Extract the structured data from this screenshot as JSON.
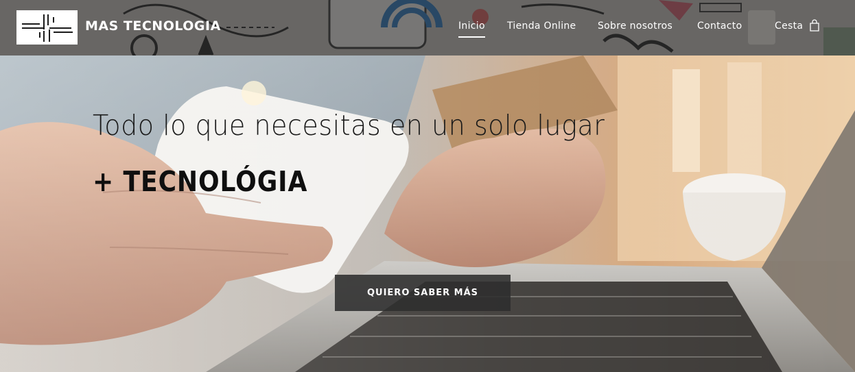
{
  "brand": {
    "name": "MAS TECNOLOGIA"
  },
  "nav": {
    "items": [
      {
        "label": "Inicio",
        "active": true
      },
      {
        "label": "Tienda Online",
        "active": false
      },
      {
        "label": "Sobre nosotros",
        "active": false
      },
      {
        "label": "Contacto",
        "active": false
      }
    ],
    "cart_label": "Cesta",
    "cart_icon": "shopping-bag-icon"
  },
  "hero": {
    "title": "Todo lo que necesitas en un solo lugar",
    "subtitle": "+ TECNOLÓGIA",
    "cta_label": "QUIERO SABER MÁS"
  },
  "colors": {
    "header_overlay": "#3a3a3a",
    "cta_background": "#2d2d2d",
    "text_light": "#ffffff",
    "text_dark": "#1a1a1a"
  }
}
